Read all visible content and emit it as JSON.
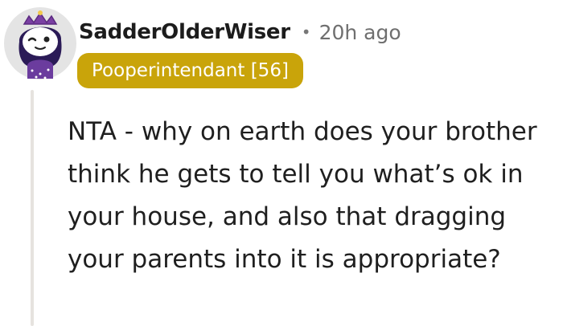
{
  "comment": {
    "author": "SadderOlderWiser",
    "separator": "•",
    "age": "20h ago",
    "flair": "Pooperintendant [56]",
    "body": "NTA - why on earth does your brother think he gets to tell you what’s ok in your house, and also that dragging your parents into it is appropriate?"
  },
  "colors": {
    "flair_background": "#c9a40a",
    "flair_text": "#ffffff",
    "author": "#1c1c1c",
    "meta": "#6f6f6f",
    "body": "#1f1f1f",
    "thread_line": "#e6e3df"
  },
  "icons": {
    "avatar": "snoo-avatar-icon"
  }
}
